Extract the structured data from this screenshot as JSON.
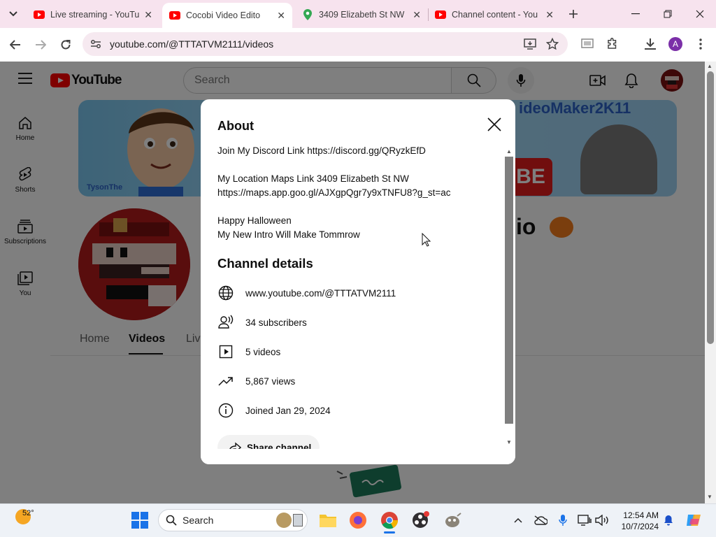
{
  "browser": {
    "tabs": [
      {
        "title": "Live streaming - YouTu",
        "favicon": "youtube-icon",
        "active": false
      },
      {
        "title": "Cocobi Video Edito",
        "favicon": "youtube-icon",
        "active": true
      },
      {
        "title": "3409 Elizabeth St NW",
        "favicon": "maps-pin-icon",
        "active": false
      },
      {
        "title": "Channel content - You",
        "favicon": "youtube-icon",
        "active": false
      }
    ],
    "url": "youtube.com/@TTTATVM2111/videos",
    "profile_initial": "A"
  },
  "youtube": {
    "logo_text": "YouTube",
    "search_placeholder": "Search",
    "sidebar": [
      {
        "label": "Home",
        "icon": "home-icon"
      },
      {
        "label": "Shorts",
        "icon": "shorts-icon"
      },
      {
        "label": "Subscriptions",
        "icon": "subscriptions-icon"
      },
      {
        "label": "You",
        "icon": "you-icon"
      }
    ],
    "banner_text": "ideoMaker2K11",
    "banner_subtext": "TysonThe",
    "banner_badge": "BE",
    "channel_name_fragment": "io",
    "channel_tabs": [
      "Home",
      "Videos",
      "Liv"
    ],
    "selected_tab": "Videos"
  },
  "about_dialog": {
    "title": "About",
    "description_lines": [
      "Join My Discord Link https://discord.gg/QRyzkEfD",
      "My Location Maps Link 3409 Elizabeth St NW",
      "https://maps.app.goo.gl/AJXgpQgr7y9xTNFU8?g_st=ac",
      "Happy Halloween",
      "My New Intro Will Make Tommrow"
    ],
    "details_heading": "Channel details",
    "details": [
      {
        "icon": "globe-icon",
        "text": "www.youtube.com/@TTTATVM2111"
      },
      {
        "icon": "subscribers-icon",
        "text": "34 subscribers"
      },
      {
        "icon": "video-icon",
        "text": "5 videos"
      },
      {
        "icon": "trending-icon",
        "text": "5,867 views"
      },
      {
        "icon": "info-icon",
        "text": "Joined Jan 29, 2024"
      }
    ],
    "share_label": "Share channel"
  },
  "taskbar": {
    "weather_temp": "52°",
    "search_label": "Search",
    "time": "12:54 AM",
    "date": "10/7/2024"
  },
  "colors": {
    "accent_red": "#ff0000",
    "chrome_tab_bg": "#f7e3ee",
    "overlay": "rgba(0,0,0,0.5)"
  }
}
